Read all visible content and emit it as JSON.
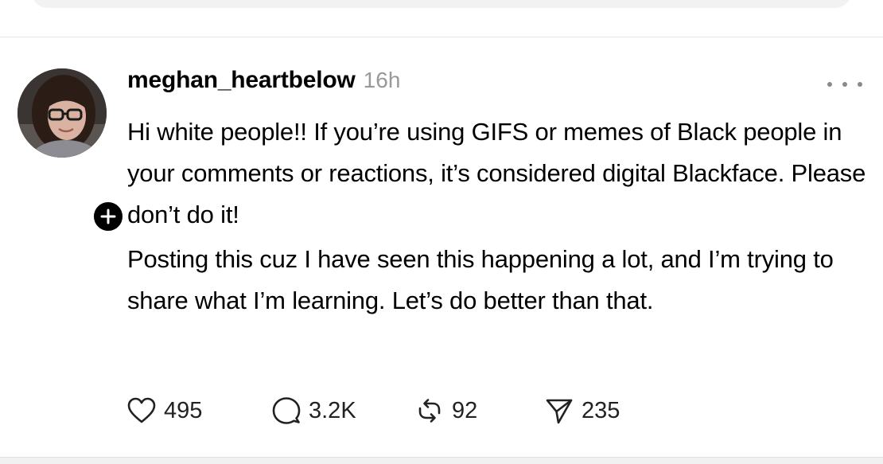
{
  "post": {
    "author": {
      "username": "meghan_heartbelow",
      "avatar_icon": "profile-photo"
    },
    "timestamp": "16h",
    "paragraphs": [
      "Hi white people!! If you’re using GIFS or memes of Black people in your comments or reactions, it’s considered digital Blackface. Please don’t do it!",
      "Posting this cuz I have seen this happening a lot, and I’m trying to share what I’m learning. Let’s do better than that."
    ],
    "actions": {
      "likes": "495",
      "replies": "3.2K",
      "reposts": "92",
      "shares": "235"
    }
  },
  "icons": {
    "follow": "plus-icon",
    "more": "more-options-icon",
    "like": "heart-icon",
    "reply": "comment-icon",
    "repost": "repost-icon",
    "share": "send-icon"
  },
  "colors": {
    "text": "#000000",
    "muted": "#999999",
    "icon": "#222222",
    "divider": "#e6e6e6"
  }
}
